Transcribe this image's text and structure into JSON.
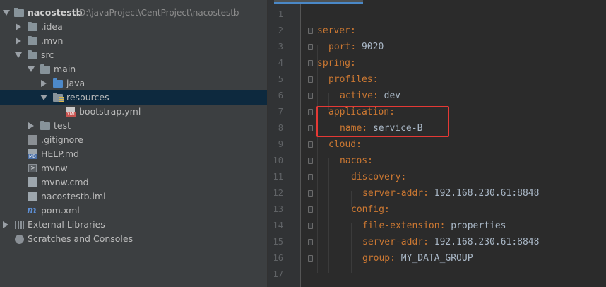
{
  "project": {
    "root_name": "nacostestb",
    "root_path": "D:\\javaProject\\CentProject\\nacostestb",
    "items": {
      "idea": ".idea",
      "mvn": ".mvn",
      "src": "src",
      "main": "main",
      "java": "java",
      "resources": "resources",
      "bootstrap": "bootstrap.yml",
      "test": "test",
      "gitignore": ".gitignore",
      "help": "HELP.md",
      "mvnw": "mvnw",
      "mvnwcmd": "mvnw.cmd",
      "iml": "nacostestb.iml",
      "pom": "pom.xml",
      "libs": "External Libraries",
      "scratches": "Scratches and Consoles"
    }
  },
  "editor": {
    "line_numbers": [
      "1",
      "2",
      "3",
      "4",
      "5",
      "6",
      "7",
      "8",
      "9",
      "10",
      "11",
      "12",
      "13",
      "14",
      "15",
      "16",
      "17"
    ],
    "lines": [
      {
        "key": "",
        "sep": "",
        "val": ""
      },
      {
        "key": "server",
        "sep": ":",
        "val": ""
      },
      {
        "key": "port",
        "sep": ":",
        "val": " 9020"
      },
      {
        "key": "spring",
        "sep": ":",
        "val": ""
      },
      {
        "key": "profiles",
        "sep": ":",
        "val": ""
      },
      {
        "key": "active",
        "sep": ":",
        "val": " dev"
      },
      {
        "key": "application",
        "sep": ":",
        "val": ""
      },
      {
        "key": "name",
        "sep": ":",
        "val": " service-B"
      },
      {
        "key": "cloud",
        "sep": ":",
        "val": ""
      },
      {
        "key": "nacos",
        "sep": ":",
        "val": ""
      },
      {
        "key": "discovery",
        "sep": ":",
        "val": ""
      },
      {
        "key": "server-addr",
        "sep": ":",
        "val": " 192.168.230.61:8848"
      },
      {
        "key": "config",
        "sep": ":",
        "val": ""
      },
      {
        "key": "file-extension",
        "sep": ":",
        "val": " properties"
      },
      {
        "key": "server-addr",
        "sep": ":",
        "val": " 192.168.230.61:8848"
      },
      {
        "key": "group",
        "sep": ":",
        "val": " MY_DATA_GROUP"
      },
      {
        "key": "",
        "sep": "",
        "val": ""
      }
    ]
  },
  "colors": {
    "key": "#cc7832",
    "value": "#a9b7c6",
    "selection": "#0d293e",
    "highlight_box": "#e53935"
  }
}
